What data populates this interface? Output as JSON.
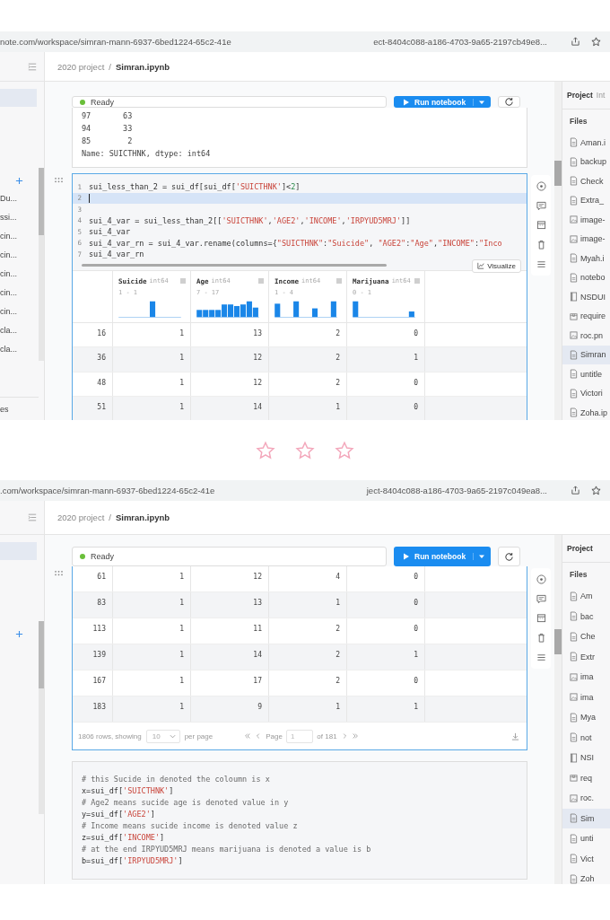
{
  "panels": [
    {
      "url_left": "note.com/workspace/simran-mann-6937-6bed1224-65c2-41e",
      "url_right": "ect-8404c088-a186-4703-9a65-2197cb49e8...",
      "breadcrumb": {
        "project": "2020 project",
        "separator": "/",
        "file": "Simran.ipynb"
      },
      "sidebar_items": [
        "Du...",
        "ssi...",
        "cin...",
        "cin...",
        "cin...",
        "cin...",
        "cin...",
        "cla...",
        "cla..."
      ],
      "sidebar_footer": "es",
      "status": "Ready",
      "run_button": "Run notebook",
      "files_title": "Project",
      "files_tab": "Int",
      "files_heading": "Files",
      "files": [
        {
          "name": "Aman.i",
          "kind": "file",
          "selected": false
        },
        {
          "name": "backup",
          "kind": "file",
          "selected": false
        },
        {
          "name": "Check",
          "kind": "file",
          "selected": false
        },
        {
          "name": "Extra_",
          "kind": "file",
          "selected": false
        },
        {
          "name": "image-",
          "kind": "image",
          "selected": false
        },
        {
          "name": "image-",
          "kind": "image",
          "selected": false
        },
        {
          "name": "Myah.i",
          "kind": "file",
          "selected": false
        },
        {
          "name": "notebo",
          "kind": "file",
          "selected": false
        },
        {
          "name": "NSDUI",
          "kind": "notebook",
          "selected": false
        },
        {
          "name": "require",
          "kind": "package",
          "selected": false
        },
        {
          "name": "roc.pn",
          "kind": "image",
          "selected": false
        },
        {
          "name": "Simran",
          "kind": "file",
          "selected": true
        },
        {
          "name": "untitle",
          "kind": "file",
          "selected": false
        },
        {
          "name": "Victori",
          "kind": "file",
          "selected": false
        },
        {
          "name": "Zoha.ip",
          "kind": "file",
          "selected": false
        }
      ],
      "cells": [
        {
          "kind": "output",
          "selected": false,
          "output_lines": [
            "97       63",
            "94       33",
            "85        2",
            "Name: SUICTHNK, dtype: int64"
          ]
        },
        {
          "kind": "code",
          "selected": true,
          "visualize": "Visualize",
          "lines": [
            {
              "number": "1",
              "active": false,
              "segments": [
                {
                  "text": "sui_less_than_2 = sui_df[sui_df[",
                  "kind": "plain"
                },
                {
                  "text": "'SUICTHNK'",
                  "kind": "string"
                },
                {
                  "text": "]<",
                  "kind": "plain"
                },
                {
                  "text": "2",
                  "kind": "number"
                },
                {
                  "text": "]",
                  "kind": "plain"
                }
              ]
            },
            {
              "number": "2",
              "active": true
            },
            {
              "number": "3",
              "active": false
            },
            {
              "number": "4",
              "active": false,
              "segments": [
                {
                  "text": "sui_4_var = sui_less_than_2[[",
                  "kind": "plain"
                },
                {
                  "text": "'SUICTHNK'",
                  "kind": "string"
                },
                {
                  "text": ",",
                  "kind": "plain"
                },
                {
                  "text": "'AGE2'",
                  "kind": "string"
                },
                {
                  "text": ",",
                  "kind": "plain"
                },
                {
                  "text": "'INCOME'",
                  "kind": "string"
                },
                {
                  "text": ",",
                  "kind": "plain"
                },
                {
                  "text": "'IRPYUD5MRJ'",
                  "kind": "string"
                },
                {
                  "text": "]]",
                  "kind": "plain"
                }
              ]
            },
            {
              "number": "5",
              "active": false,
              "segments": [
                {
                  "text": "sui_4_var",
                  "kind": "plain"
                }
              ]
            },
            {
              "number": "6",
              "active": false,
              "segments": [
                {
                  "text": "sui_4_var_rn = sui_4_var.rename(columns={",
                  "kind": "plain"
                },
                {
                  "text": "\"SUICTHNK\"",
                  "kind": "string"
                },
                {
                  "text": ":",
                  "kind": "plain"
                },
                {
                  "text": "\"Suicide\"",
                  "kind": "string"
                },
                {
                  "text": ", ",
                  "kind": "plain"
                },
                {
                  "text": "\"AGE2\"",
                  "kind": "string"
                },
                {
                  "text": ":",
                  "kind": "plain"
                },
                {
                  "text": "\"Age\"",
                  "kind": "string"
                },
                {
                  "text": ",",
                  "kind": "plain"
                },
                {
                  "text": "\"INCOME\"",
                  "kind": "string"
                },
                {
                  "text": ":",
                  "kind": "plain"
                },
                {
                  "text": "\"Inco",
                  "kind": "string"
                }
              ]
            },
            {
              "number": "7",
              "active": false,
              "segments": [
                {
                  "text": "sui_4_var_rn",
                  "kind": "plain"
                }
              ]
            }
          ],
          "table": {
            "columns": [
              {
                "name": "Suicide",
                "dtype": "int64",
                "range": "1 - 1"
              },
              {
                "name": "Age",
                "dtype": "int64",
                "range": "7 - 17"
              },
              {
                "name": "Income",
                "dtype": "int64",
                "range": "1 - 4"
              },
              {
                "name": "Marijuana",
                "dtype": "int64",
                "range": "0 - 1"
              }
            ],
            "rows": [
              {
                "index": "16",
                "values": [
                  "1",
                  "13",
                  "2",
                  "0"
                ]
              },
              {
                "index": "36",
                "values": [
                  "1",
                  "12",
                  "2",
                  "1"
                ]
              },
              {
                "index": "48",
                "values": [
                  "1",
                  "12",
                  "2",
                  "0"
                ]
              },
              {
                "index": "51",
                "values": [
                  "1",
                  "14",
                  "1",
                  "0"
                ]
              }
            ]
          }
        }
      ]
    },
    {
      "url_left": ".com/workspace/simran-mann-6937-6bed1224-65c2-41e",
      "url_right": "ject-8404c088-a186-4703-9a65-2197c049ea8...",
      "breadcrumb": {
        "project": "2020 project",
        "separator": "/",
        "file": "Simran.ipynb"
      },
      "status": "Ready",
      "run_button": "Run notebook",
      "files_title": "Project",
      "files_heading": "Files",
      "files": [
        {
          "name": "Am",
          "kind": "file",
          "selected": false
        },
        {
          "name": "bac",
          "kind": "file",
          "selected": false
        },
        {
          "name": "Che",
          "kind": "file",
          "selected": false
        },
        {
          "name": "Extr",
          "kind": "file",
          "selected": false
        },
        {
          "name": "ima",
          "kind": "image",
          "selected": false
        },
        {
          "name": "ima",
          "kind": "image",
          "selected": false
        },
        {
          "name": "Mya",
          "kind": "file",
          "selected": false
        },
        {
          "name": "not",
          "kind": "file",
          "selected": false
        },
        {
          "name": "NSI",
          "kind": "notebook",
          "selected": false
        },
        {
          "name": "req",
          "kind": "package",
          "selected": false
        },
        {
          "name": "roc.",
          "kind": "image",
          "selected": false
        },
        {
          "name": "Sim",
          "kind": "file",
          "selected": true
        },
        {
          "name": "unti",
          "kind": "file",
          "selected": false
        },
        {
          "name": "Vict",
          "kind": "file",
          "selected": false
        },
        {
          "name": "Zoh",
          "kind": "file",
          "selected": false
        }
      ],
      "cells": [
        {
          "kind": "table",
          "selected": true,
          "table": {
            "rows": [
              {
                "index": "61",
                "values": [
                  "1",
                  "12",
                  "4",
                  "0"
                ]
              },
              {
                "index": "83",
                "values": [
                  "1",
                  "13",
                  "1",
                  "0"
                ]
              },
              {
                "index": "113",
                "values": [
                  "1",
                  "11",
                  "2",
                  "0"
                ]
              },
              {
                "index": "139",
                "values": [
                  "1",
                  "14",
                  "2",
                  "1"
                ]
              },
              {
                "index": "167",
                "values": [
                  "1",
                  "17",
                  "2",
                  "0"
                ]
              },
              {
                "index": "183",
                "values": [
                  "1",
                  "9",
                  "1",
                  "1"
                ]
              }
            ],
            "footer": {
              "rows_text": "1806 rows, showing",
              "page_size": "10",
              "per_page": "per page",
              "page_label": "Page",
              "page": "1",
              "of_pages": "of 181"
            }
          }
        },
        {
          "kind": "code",
          "selected": false,
          "lines": [
            {
              "segments": [
                {
                  "text": "# this Sucide in denoted the coloumn is x",
                  "kind": "comment"
                }
              ]
            },
            {
              "segments": [
                {
                  "text": "x=sui_df[",
                  "kind": "plain"
                },
                {
                  "text": "'SUICTHNK'",
                  "kind": "string"
                },
                {
                  "text": "]",
                  "kind": "plain"
                }
              ]
            },
            {
              "segments": [
                {
                  "text": "# Age2 means sucide age is denoted value in y",
                  "kind": "comment"
                }
              ]
            },
            {
              "segments": [
                {
                  "text": "y=sui_df[",
                  "kind": "plain"
                },
                {
                  "text": "'AGE2'",
                  "kind": "string"
                },
                {
                  "text": "]",
                  "kind": "plain"
                }
              ]
            },
            {
              "segments": [
                {
                  "text": "# Income means sucide income is denoted value z",
                  "kind": "comment"
                }
              ]
            },
            {
              "segments": [
                {
                  "text": "z=sui_df[",
                  "kind": "plain"
                },
                {
                  "text": "'INCOME'",
                  "kind": "string"
                },
                {
                  "text": "]",
                  "kind": "plain"
                }
              ]
            },
            {
              "segments": [
                {
                  "text": "# at the end IRPYUD5MRJ means marijuana is denoted a value is b",
                  "kind": "comment"
                }
              ]
            },
            {
              "segments": [
                {
                  "text": "b=sui_df[",
                  "kind": "plain"
                },
                {
                  "text": "'IRPYUD5MRJ'",
                  "kind": "string"
                },
                {
                  "text": "]",
                  "kind": "plain"
                }
              ]
            }
          ]
        }
      ]
    }
  ]
}
